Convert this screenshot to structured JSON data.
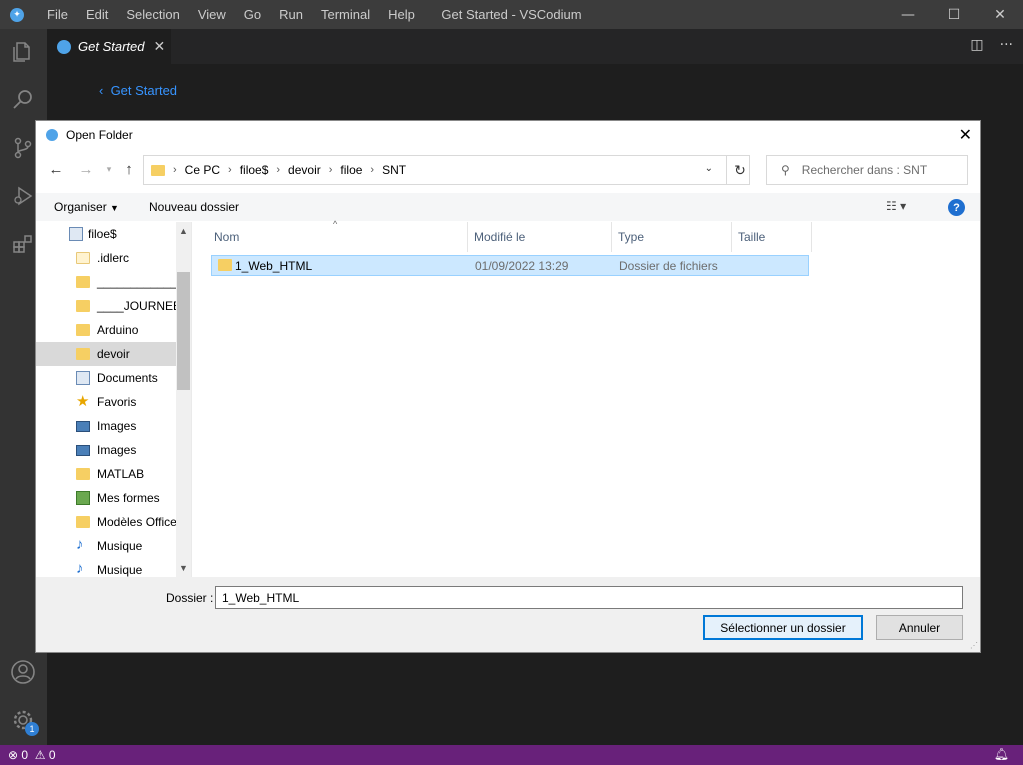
{
  "titlebar": {
    "menu": [
      "File",
      "Edit",
      "Selection",
      "View",
      "Go",
      "Run",
      "Terminal",
      "Help"
    ],
    "window_title": "Get Started - VSCodium"
  },
  "tabs": {
    "active_label": "Get Started"
  },
  "editor": {
    "back_link": "Get Started"
  },
  "statusbar": {
    "errors": "0",
    "warnings": "0",
    "badge": "1"
  },
  "dialog": {
    "title": "Open Folder",
    "breadcrumb": [
      "Ce PC",
      "filoe$",
      "devoir",
      "filoe",
      "SNT"
    ],
    "search_placeholder": "Rechercher dans : SNT",
    "toolbar": {
      "organize": "Organiser",
      "new_folder": "Nouveau dossier"
    },
    "nav_items": [
      {
        "label": "filoe$",
        "icon": "document-icon"
      },
      {
        "label": ".idlerc",
        "icon": "folder-icon"
      },
      {
        "label": "_______________",
        "icon": "folder-icon"
      },
      {
        "label": "____JOURNEE_",
        "icon": "folder-icon"
      },
      {
        "label": "Arduino",
        "icon": "folder-icon"
      },
      {
        "label": "devoir",
        "icon": "folder-icon",
        "selected": true
      },
      {
        "label": "Documents",
        "icon": "document-icon"
      },
      {
        "label": "Favoris",
        "icon": "star-icon"
      },
      {
        "label": "Images",
        "icon": "image-icon"
      },
      {
        "label": "Images",
        "icon": "image-icon"
      },
      {
        "label": "MATLAB",
        "icon": "folder-icon"
      },
      {
        "label": "Mes formes",
        "icon": "forms-icon"
      },
      {
        "label": "Modèles Office",
        "icon": "folder-icon"
      },
      {
        "label": "Musique",
        "icon": "music-icon"
      },
      {
        "label": "Musique",
        "icon": "music-icon"
      }
    ],
    "columns": {
      "name": "Nom",
      "modified": "Modifié le",
      "type": "Type",
      "size": "Taille"
    },
    "files": [
      {
        "name": "1_Web_HTML",
        "modified": "01/09/2022 13:29",
        "type": "Dossier de fichiers",
        "size": ""
      }
    ],
    "folder_label": "Dossier :",
    "folder_value": "1_Web_HTML",
    "select_button": "Sélectionner un dossier",
    "cancel_button": "Annuler"
  }
}
